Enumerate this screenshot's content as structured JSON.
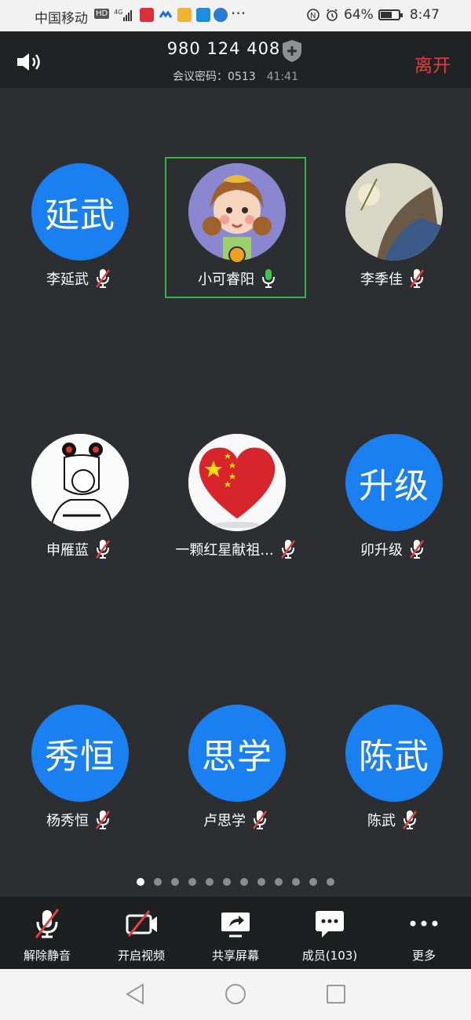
{
  "status_bar": {
    "carrier": "中国移动",
    "hd": "HD",
    "network": "4G",
    "battery": "64%",
    "battery_level": 0.64,
    "time": "8:47"
  },
  "header": {
    "meeting_id": "980 124 408",
    "password_label": "会议密码：0513",
    "duration": "41:41",
    "leave_label": "离开"
  },
  "participants": [
    {
      "name": "李延武",
      "initials": "延武",
      "muted": true
    },
    {
      "name": "小可睿阳",
      "initials": "",
      "muted": false,
      "active": true
    },
    {
      "name": "李季佳",
      "initials": "",
      "muted": true
    },
    {
      "name": "申雁蓝",
      "initials": "",
      "muted": true
    },
    {
      "name": "一颗红星献祖...",
      "initials": "",
      "muted": true
    },
    {
      "name": "卯升级",
      "initials": "升级",
      "muted": true
    },
    {
      "name": "杨秀恒",
      "initials": "秀恒",
      "muted": true
    },
    {
      "name": "卢思学",
      "initials": "思学",
      "muted": true
    },
    {
      "name": "陈武",
      "initials": "陈武",
      "muted": true
    }
  ],
  "pagination": {
    "total": 12,
    "current": 1
  },
  "toolbar": {
    "unmute": "解除静音",
    "start_video": "开启视频",
    "share_screen": "共享屏幕",
    "members": "成员(103)",
    "more": "更多"
  },
  "colors": {
    "background": "#2c2e31",
    "header": "#212224",
    "avatar_blue": "#1a7ff0",
    "leave_red": "#e0413e",
    "active_green": "#33b34a",
    "mute_red": "#e0413e"
  }
}
